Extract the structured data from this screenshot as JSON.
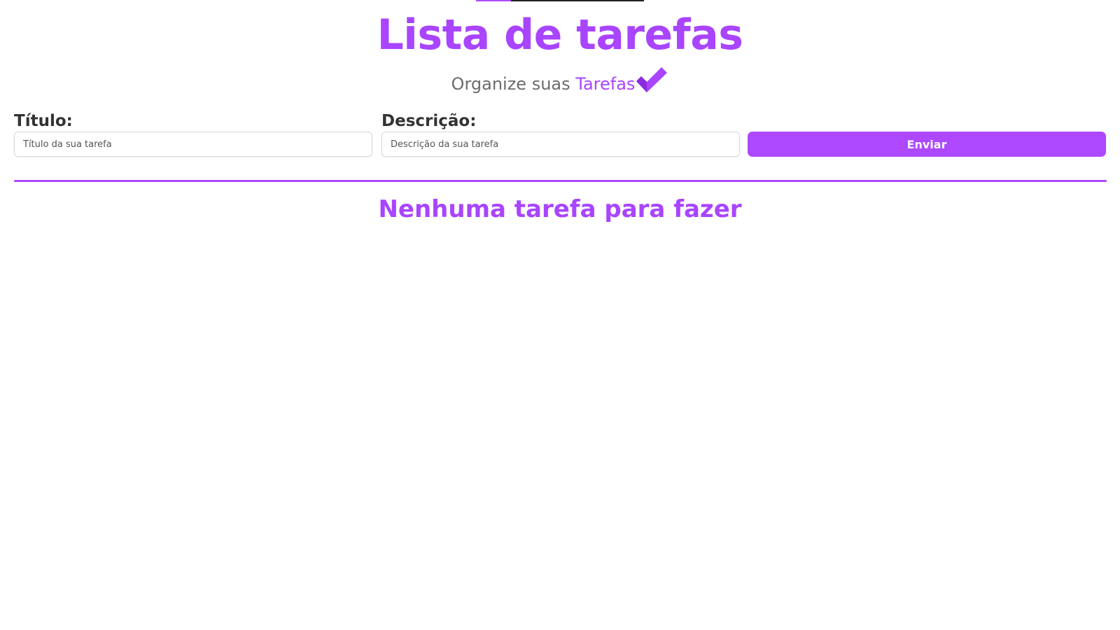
{
  "header": {
    "title": "Lista de tarefas",
    "subtitle_prefix": "Organize suas",
    "subtitle_accent": "Tarefas",
    "icon": "check-icon"
  },
  "form": {
    "title_label": "Título:",
    "title_placeholder": "Título da sua tarefa",
    "title_value": "",
    "description_label": "Descrição:",
    "description_placeholder": "Descrição da sua tarefa",
    "description_value": "",
    "submit_label": "Enviar"
  },
  "tasks": {
    "empty_message": "Nenhuma tarefa para fazer",
    "items": []
  },
  "colors": {
    "accent": "#ae48ff",
    "text_dark": "#333333",
    "text_muted": "#6b6b6b"
  }
}
